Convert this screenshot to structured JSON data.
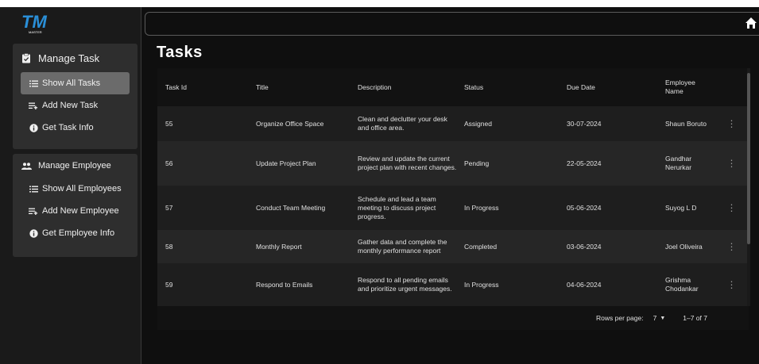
{
  "app": {
    "logo_text": "TM",
    "logo_subtext": "MASTER"
  },
  "sidebar": {
    "task_section": {
      "title": "Manage Task",
      "items": [
        {
          "label": "Show All Tasks",
          "icon": "list-icon",
          "active": true
        },
        {
          "label": "Add New Task",
          "icon": "playlist-add-icon",
          "active": false
        },
        {
          "label": "Get Task Info",
          "icon": "info-icon",
          "active": false
        }
      ]
    },
    "employee_section": {
      "title": "Manage Employee",
      "items": [
        {
          "label": "Show All Employees",
          "icon": "list-icon",
          "active": false
        },
        {
          "label": "Add New Employee",
          "icon": "playlist-add-icon",
          "active": false
        },
        {
          "label": "Get Employee Info",
          "icon": "info-icon",
          "active": false
        }
      ]
    }
  },
  "header": {
    "search_value": "",
    "home_icon": "home-icon"
  },
  "page": {
    "title": "Tasks"
  },
  "table": {
    "columns": [
      "Task Id",
      "Title",
      "Description",
      "Status",
      "Due Date",
      "Employee Name"
    ],
    "rows": [
      {
        "id": "55",
        "title": "Organize Office Space",
        "description": "Clean and declutter your desk and office area.",
        "status": "Assigned",
        "due": "30-07-2024",
        "employee": "Shaun Boruto"
      },
      {
        "id": "56",
        "title": "Update Project Plan",
        "description": "Review and update the current project plan with recent changes.",
        "status": "Pending",
        "due": "22-05-2024",
        "employee": "Gandhar Nerurkar"
      },
      {
        "id": "57",
        "title": "Conduct Team Meeting",
        "description": "Schedule and lead a team meeting to discuss project progress.",
        "status": "In Progress",
        "due": "05-06-2024",
        "employee": "Suyog L D"
      },
      {
        "id": "58",
        "title": "Monthly Report",
        "description": "Gather data and complete the monthly performance report",
        "status": "Completed",
        "due": "03-06-2024",
        "employee": "Joel Oliveira"
      },
      {
        "id": "59",
        "title": "Respond to Emails",
        "description": "Respond to all pending emails and prioritize urgent messages.",
        "status": "In Progress",
        "due": "04-06-2024",
        "employee": "Grishma Chodankar"
      }
    ],
    "footer": {
      "rows_per_page_label": "Rows per page:",
      "rows_per_page_value": "7",
      "range": "1–7 of 7"
    }
  },
  "colors": {
    "background": "#0f0f0f",
    "sidebar_panel": "#2e2e2e",
    "active_item": "#6b6b6b",
    "logo_blue": "#2a8fd8"
  }
}
